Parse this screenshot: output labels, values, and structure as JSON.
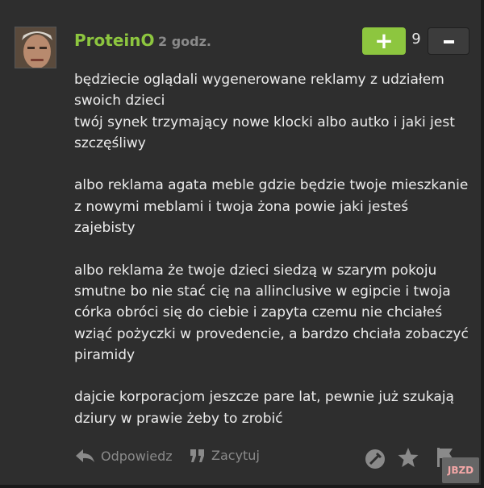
{
  "comment": {
    "author": "ProteinO",
    "time": "2 godz.",
    "score": "9",
    "paragraphs": [
      "będziecie oglądali wygenerowane reklamy z udziałem swoich dzieci\ntwój synek trzymający nowe klocki albo autko i jaki jest szczęśliwy",
      "albo reklama agata meble gdzie będzie twoje mieszkanie z nowymi meblami i twoja żona powie jaki jesteś zajebisty",
      "albo reklama że twoje dzieci siedzą w szarym pokoju smutne bo nie stać cię na allinclusive w egipcie i twoja córka obróci się do ciebie i zapyta czemu nie chciałeś wziąć pożyczki w provedencie, a bardzo chciała zobaczyć piramidy",
      "dajcie korporacjom jeszcze pare lat, pewnie już szukają dziury w prawie żeby to zrobić"
    ]
  },
  "vote": {
    "plus": "+",
    "minus_icon": "minus-icon"
  },
  "actions": {
    "reply": "Odpowiedz",
    "quote": "Zacytuj"
  },
  "icons": {
    "reply": "reply-arrow-icon",
    "quote": "quote-icon",
    "pin": "pin-icon",
    "star": "star-icon",
    "flag": "flag-icon"
  },
  "watermark": "JBZD",
  "colors": {
    "accent": "#8dc63f",
    "background": "#2e2e2e",
    "muted": "#8a8a8a"
  }
}
